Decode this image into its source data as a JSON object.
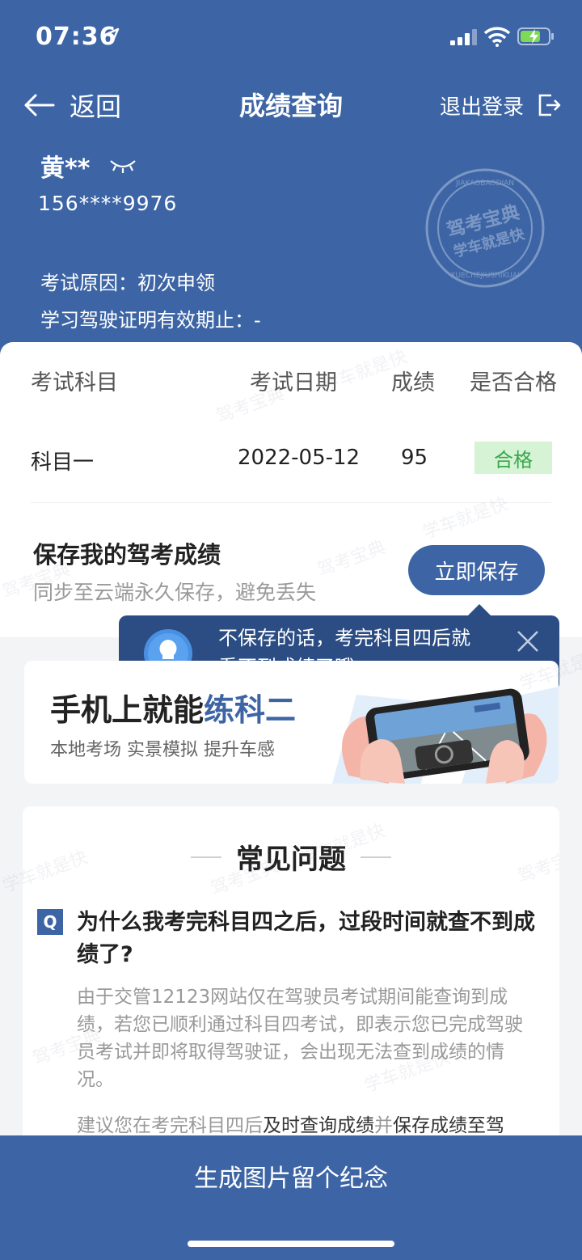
{
  "status_bar": {
    "time": "07:36"
  },
  "nav": {
    "back_label": "返回",
    "title": "成绩查询",
    "logout_label": "退出登录"
  },
  "user": {
    "name": "黄**",
    "phone": "156****9976",
    "reason": "考试原因：初次申领",
    "validity": "学习驾驶证明有效期止：-"
  },
  "stamp": {
    "text_top": "JIAKAOBAODIAN",
    "line1": "驾考宝典",
    "line2": "学车就是快",
    "text_bottom": "XUECHEJIUSHIKUAI"
  },
  "table": {
    "headers": [
      "考试科目",
      "考试日期",
      "成绩",
      "是否合格"
    ],
    "rows": [
      {
        "subject": "科目一",
        "date": "2022-05-12",
        "score": "95",
        "result": "合格"
      }
    ]
  },
  "save_card": {
    "title": "保存我的驾考成绩",
    "subtitle": "同步至云端永久保存，避免丢失",
    "button": "立即保存"
  },
  "tooltip": {
    "line1": "不保存的话，考完科目四后就",
    "line2": "看不到成绩了哦～"
  },
  "promo": {
    "title_prefix": "手机上就能",
    "title_highlight": "练科二",
    "subtitle": "本地考场 实景模拟 提升车感"
  },
  "faq": {
    "title": "常见问题",
    "q_badge": "Q",
    "question": "为什么我考完科目四之后，过段时间就查不到成绩了?",
    "answer": "由于交管12123网站仅在驾驶员考试期间能查询到成绩，若您已顺利通过科目四考试，即表示您已完成驾驶员考试并即将取得驾驶证，会出现无法查到成绩的情况。",
    "answer2_a": "建议您在考完科目四后",
    "answer2_b": "及时查询成绩",
    "answer2_c": "并",
    "answer2_d": "保存成绩至驾"
  },
  "bottom": {
    "button": "生成图片留个纪念"
  },
  "watermark": {
    "text1": "驾考宝典",
    "text2": "学车就是快"
  },
  "colors": {
    "primary": "#3d65a5",
    "tooltip": "#2b4d84",
    "pass_bg": "#d6f3d6",
    "pass_text": "#3aa74c"
  }
}
